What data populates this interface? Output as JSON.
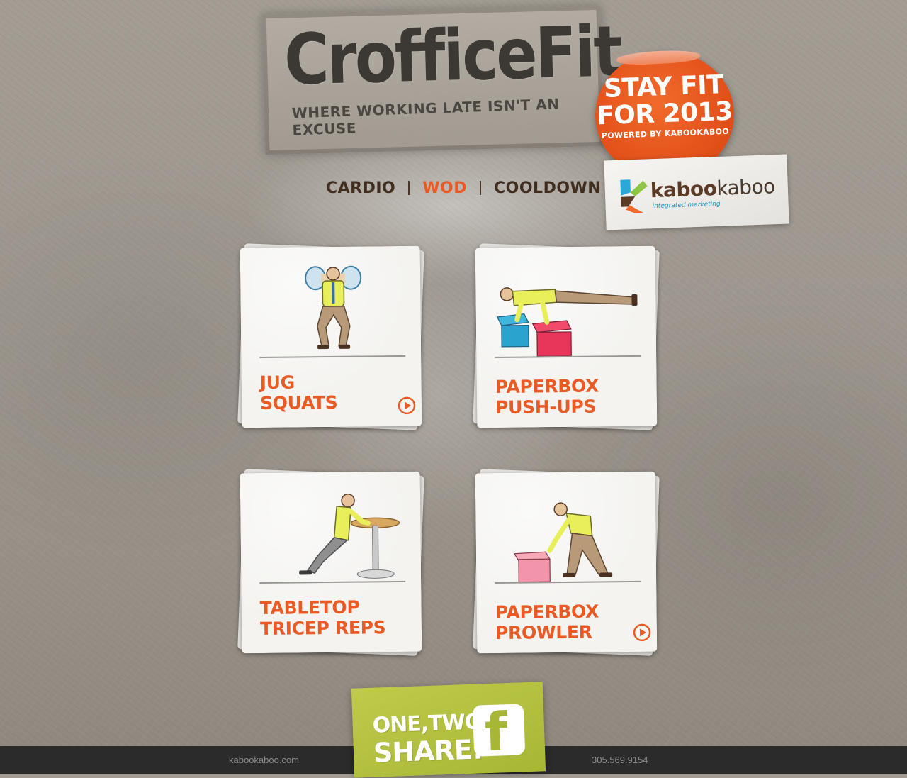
{
  "logo": {
    "title": "CrofficeFit",
    "tagline": "WHERE WORKING LATE ISN'T AN EXCUSE"
  },
  "nav": {
    "items": [
      {
        "label": "CARDIO",
        "active": false
      },
      {
        "label": "WOD",
        "active": true
      },
      {
        "label": "COOLDOWN",
        "active": false
      }
    ]
  },
  "badge": {
    "line1": "STAY FIT",
    "line2": "FOR 2013",
    "line3": "POWERED BY KABOOKABOO"
  },
  "sponsor": {
    "name_a": "kaboo",
    "name_b": "kaboo",
    "tagline": "integrated marketing"
  },
  "workouts": [
    {
      "label_line1": "JUG",
      "label_line2": "SQUATS",
      "icon": "play-icon",
      "has_play": true
    },
    {
      "label_line1": "PAPERBOX",
      "label_line2": "PUSH-UPS",
      "icon": "play-icon",
      "has_play": false
    },
    {
      "label_line1": "TABLETOP",
      "label_line2": "TRICEP REPS",
      "icon": "play-icon",
      "has_play": false
    },
    {
      "label_line1": "PAPERBOX",
      "label_line2": "PROWLER",
      "icon": "play-icon",
      "has_play": true
    }
  ],
  "share": {
    "line1": "ONE,TWO,",
    "line2": "SHARE!",
    "icon": "facebook-icon",
    "icon_glyph": "f"
  },
  "footer": {
    "website": "kabookaboo.com",
    "phone": "305.569.9154"
  },
  "colors": {
    "accent": "#ea5a24",
    "nav_text": "#3f2d1f",
    "share_green": "#a8b636",
    "footer_bg": "#2b2b2b"
  }
}
